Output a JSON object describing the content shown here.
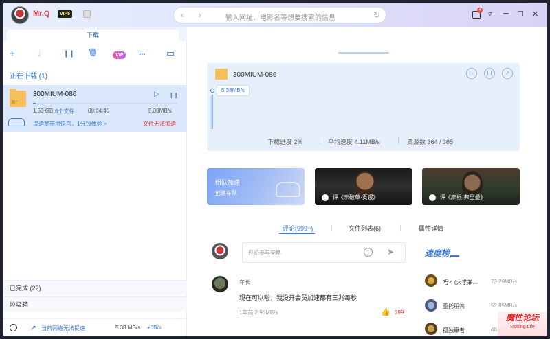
{
  "header": {
    "username": "Mr.Q",
    "vip_badge": "VIP5",
    "search_placeholder": "输入网址、电影名等想要搜索的信息",
    "message_count": "4",
    "nav_back": "‹",
    "nav_forward": "›",
    "refresh": "↻",
    "menu": "▿",
    "minimize": "─",
    "maximize": "☐",
    "close": "✕"
  },
  "sidebar": {
    "tab_label": "下载",
    "toolbar": {
      "add": "+",
      "download": "↓",
      "pause": "❙❙",
      "delete": "🗑",
      "vip": "VIP",
      "more": "•••",
      "screen": "▭"
    },
    "section_title": "正在下载 (1)",
    "task": {
      "name": "300MIUM-086",
      "folder_tag": "BT",
      "play": "▷",
      "pause": "❙❙",
      "size": "1.53 GB",
      "files": "6个文件",
      "elapsed": "00:04:46",
      "speed": "5.38MB/s",
      "progress": 0.02,
      "promo_link": "提速宽带用快鸟，1分钱体验 >",
      "warning": "文件无法加速"
    },
    "completed": "已完成 (22)",
    "trash": "垃圾箱",
    "status": {
      "network": "当前网络无法提速",
      "speed": "5.38 MB/s",
      "plus": "+0B/s"
    }
  },
  "detail": {
    "name": "300MIUM-086",
    "speed_bubble": "5.38MB/s",
    "progress_label": "下载进度 2%",
    "avg_speed": "平均速度 4.11MB/s",
    "sources": "资源数 364 / 365",
    "play_icon": "▷",
    "pause_icon": "❙❙",
    "open_icon": "↗"
  },
  "cards": {
    "team_title": "组队加速",
    "team_sub": "创建车队",
    "movie1_review": "评《示破草·贡谡》",
    "movie2_review": "评《摩根·弗里曼》"
  },
  "tabs": {
    "comments": "评论(999+)",
    "files": "文件列表(6)",
    "properties": "属性详情"
  },
  "comment_box": {
    "placeholder": "评论参与党格"
  },
  "comment": {
    "user": "车长",
    "text": "现在可以啦，我没开会员加速都有三兆每秒",
    "time": "1年前  2.95MB/s",
    "likes": "399"
  },
  "ranking": {
    "title": "速度榜",
    "items": [
      {
        "name": "唔✓ (大学兼...",
        "speed": "73.29MB/s"
      },
      {
        "name": "亚托朋亮",
        "speed": "52.85MB/s"
      },
      {
        "name": "孤独患者",
        "speed": "48.4..."
      }
    ]
  },
  "watermark": {
    "line1": "魔性论坛",
    "line2": "Moxing.Life"
  },
  "colors": {
    "accent": "#3d7bd8",
    "warning": "#e03a3a",
    "task_bg": "#dbe8fb"
  }
}
